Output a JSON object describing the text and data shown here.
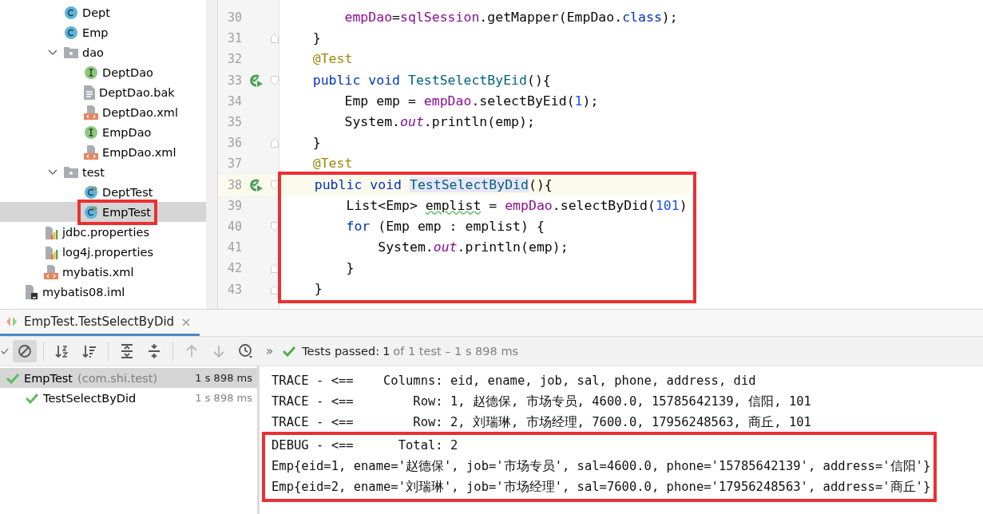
{
  "project_tree": {
    "items": [
      {
        "children": [
          {
            "children": [
              {
                "label": "Dept",
                "kind": "class",
                "selected": false,
                "highlighted": false
              },
              {
                "label": "Emp",
                "kind": "class",
                "selected": false,
                "highlighted": false
              },
              {
                "label": "dao",
                "kind": "folder",
                "expanded": true,
                "selected": false,
                "highlighted": false,
                "children": [
                  {
                    "label": "DeptDao",
                    "kind": "interface",
                    "selected": false,
                    "highlighted": false
                  },
                  {
                    "label": "DeptDao.bak",
                    "kind": "text",
                    "selected": false,
                    "highlighted": false
                  },
                  {
                    "label": "DeptDao.xml",
                    "kind": "xml",
                    "selected": false,
                    "highlighted": false
                  },
                  {
                    "label": "EmpDao",
                    "kind": "interface",
                    "selected": false,
                    "highlighted": false
                  },
                  {
                    "label": "EmpDao.xml",
                    "kind": "xml",
                    "selected": false,
                    "highlighted": false
                  }
                ]
              },
              {
                "label": "test",
                "kind": "folder",
                "expanded": true,
                "selected": false,
                "highlighted": false,
                "children": [
                  {
                    "label": "DeptTest",
                    "kind": "testclass",
                    "selected": false,
                    "highlighted": false
                  },
                  {
                    "label": "EmpTest",
                    "kind": "testclass",
                    "selected": true,
                    "highlighted": true
                  }
                ]
              }
            ]
          },
          {
            "label": "jdbc.properties",
            "kind": "properties",
            "selected": false,
            "highlighted": false
          },
          {
            "label": "log4j.properties",
            "kind": "properties",
            "selected": false,
            "highlighted": false
          },
          {
            "label": "mybatis.xml",
            "kind": "xml",
            "selected": false,
            "highlighted": false
          }
        ]
      },
      {
        "label": "mybatis08.iml",
        "kind": "module",
        "selected": false,
        "highlighted": false
      }
    ]
  },
  "editor": {
    "blocks": [
      {
        "highlighted": false,
        "lines": [
          {
            "number": "30",
            "current": false,
            "run": false,
            "fold_open": false,
            "fold_close": false,
            "parts": [
              {
                "text": "        empDao",
                "kind": "field"
              },
              {
                "text": "=",
                "kind": "plain"
              },
              {
                "text": "sqlSession",
                "kind": "field"
              },
              {
                "text": ".getMapper(EmpDao.",
                "kind": "plain"
              },
              {
                "text": "class",
                "kind": "keyword"
              },
              {
                "text": ");",
                "kind": "plain"
              }
            ]
          },
          {
            "number": "31",
            "current": false,
            "run": false,
            "fold_open": false,
            "fold_close": true,
            "parts": [
              {
                "text": "    }",
                "kind": "plain"
              }
            ]
          },
          {
            "number": "32",
            "current": false,
            "run": false,
            "fold_open": false,
            "fold_close": false,
            "parts": [
              {
                "text": "    @Test",
                "kind": "annotation"
              }
            ]
          },
          {
            "number": "33",
            "current": false,
            "run": true,
            "fold_open": true,
            "fold_close": false,
            "parts": [
              {
                "text": "    public void ",
                "kind": "keyword"
              },
              {
                "text": "TestSelectByEid",
                "kind": "method"
              },
              {
                "text": "(){",
                "kind": "plain"
              }
            ]
          },
          {
            "number": "34",
            "current": false,
            "run": false,
            "fold_open": false,
            "fold_close": false,
            "parts": [
              {
                "text": "        Emp emp = ",
                "kind": "plain"
              },
              {
                "text": "empDao",
                "kind": "field"
              },
              {
                "text": ".selectByEid(",
                "kind": "plain"
              },
              {
                "text": "1",
                "kind": "number"
              },
              {
                "text": ");",
                "kind": "plain"
              }
            ]
          },
          {
            "number": "35",
            "current": false,
            "run": false,
            "fold_open": false,
            "fold_close": false,
            "parts": [
              {
                "text": "        System.",
                "kind": "plain"
              },
              {
                "text": "out",
                "kind": "static"
              },
              {
                "text": ".println(emp);",
                "kind": "plain"
              }
            ]
          },
          {
            "number": "36",
            "current": false,
            "run": false,
            "fold_open": false,
            "fold_close": true,
            "parts": [
              {
                "text": "    }",
                "kind": "plain"
              }
            ]
          },
          {
            "number": "37",
            "current": false,
            "run": false,
            "fold_open": false,
            "fold_close": false,
            "parts": [
              {
                "text": "    @Test",
                "kind": "annotation"
              }
            ]
          }
        ]
      },
      {
        "highlighted": true,
        "lines": [
          {
            "number": "38",
            "current": true,
            "run": true,
            "fold_open": true,
            "fold_close": false,
            "parts": [
              {
                "text": "    public void ",
                "kind": "keyword"
              },
              {
                "text": "TestSelectByDid",
                "kind": "marked"
              },
              {
                "text": "(){",
                "kind": "plain"
              }
            ]
          },
          {
            "number": "39",
            "current": false,
            "run": false,
            "fold_open": false,
            "fold_close": false,
            "parts": [
              {
                "text": "        List<Emp> ",
                "kind": "plain"
              },
              {
                "text": "emplist",
                "kind": "warning"
              },
              {
                "text": " = ",
                "kind": "plain"
              },
              {
                "text": "empDao",
                "kind": "field"
              },
              {
                "text": ".selectByDid(",
                "kind": "plain"
              },
              {
                "text": "101",
                "kind": "number"
              },
              {
                "text": ")",
                "kind": "plain"
              }
            ]
          },
          {
            "number": "40",
            "current": false,
            "run": false,
            "fold_open": true,
            "fold_close": false,
            "parts": [
              {
                "text": "        for",
                "kind": "keyword"
              },
              {
                "text": " (Emp emp : emplist) {",
                "kind": "plain"
              }
            ]
          },
          {
            "number": "41",
            "current": false,
            "run": false,
            "fold_open": false,
            "fold_close": false,
            "parts": [
              {
                "text": "            System.",
                "kind": "plain"
              },
              {
                "text": "out",
                "kind": "static"
              },
              {
                "text": ".println(emp);",
                "kind": "plain"
              }
            ]
          },
          {
            "number": "42",
            "current": false,
            "run": false,
            "fold_open": false,
            "fold_close": true,
            "parts": [
              {
                "text": "        }",
                "kind": "plain"
              }
            ]
          },
          {
            "number": "43",
            "current": false,
            "run": false,
            "fold_open": false,
            "fold_close": true,
            "parts": [
              {
                "text": "    }",
                "kind": "plain"
              }
            ]
          }
        ]
      }
    ]
  },
  "run_panel": {
    "tab": {
      "label": "EmpTest.TestSelectByDid",
      "selected": true,
      "close": "×"
    },
    "toolbar": [
      {
        "kind": "check",
        "pressed": false,
        "disabled": false
      },
      {
        "kind": "stop",
        "pressed": true,
        "disabled": false
      },
      {
        "kind": "sortalpha",
        "pressed": false,
        "disabled": false
      },
      {
        "kind": "sortduration",
        "pressed": false,
        "disabled": false
      },
      {
        "kind": "expand",
        "pressed": false,
        "disabled": false
      },
      {
        "kind": "collapse",
        "pressed": false,
        "disabled": false
      },
      {
        "kind": "up",
        "pressed": false,
        "disabled": true
      },
      {
        "kind": "down",
        "pressed": false,
        "disabled": true
      },
      {
        "kind": "history",
        "pressed": false,
        "disabled": false
      }
    ],
    "more": "»",
    "status": {
      "label": "Tests passed:",
      "count": "1",
      "detail": "of 1 test – 1 s 898 ms"
    },
    "tests": [
      {
        "name": "EmpTest",
        "package": "(com.shi.test)",
        "time": "1 s 898 ms",
        "passed": true,
        "selected": true,
        "children": [
          {
            "name": "TestSelectByDid",
            "time": "1 s 898 ms",
            "passed": true,
            "selected": false
          }
        ]
      }
    ],
    "console": [
      {
        "highlighted": false,
        "lines": [
          "TRACE - <==    Columns: eid, ename, job, sal, phone, address, did",
          "TRACE - <==        Row: 1, 赵德保, 市场专员, 4600.0, 15785642139, 信阳, 101",
          "TRACE - <==        Row: 2, 刘瑞琳, 市场经理, 7600.0, 17956248563, 商丘, 101"
        ]
      },
      {
        "highlighted": true,
        "lines": [
          "DEBUG - <==      Total: 2",
          "Emp{eid=1, ename='赵德保', job='市场专员', sal=4600.0, phone='15785642139', address='信阳'}",
          "Emp{eid=2, ename='刘瑞琳', job='市场经理', sal=7600.0, phone='17956248563', address='商丘'}"
        ]
      }
    ]
  }
}
